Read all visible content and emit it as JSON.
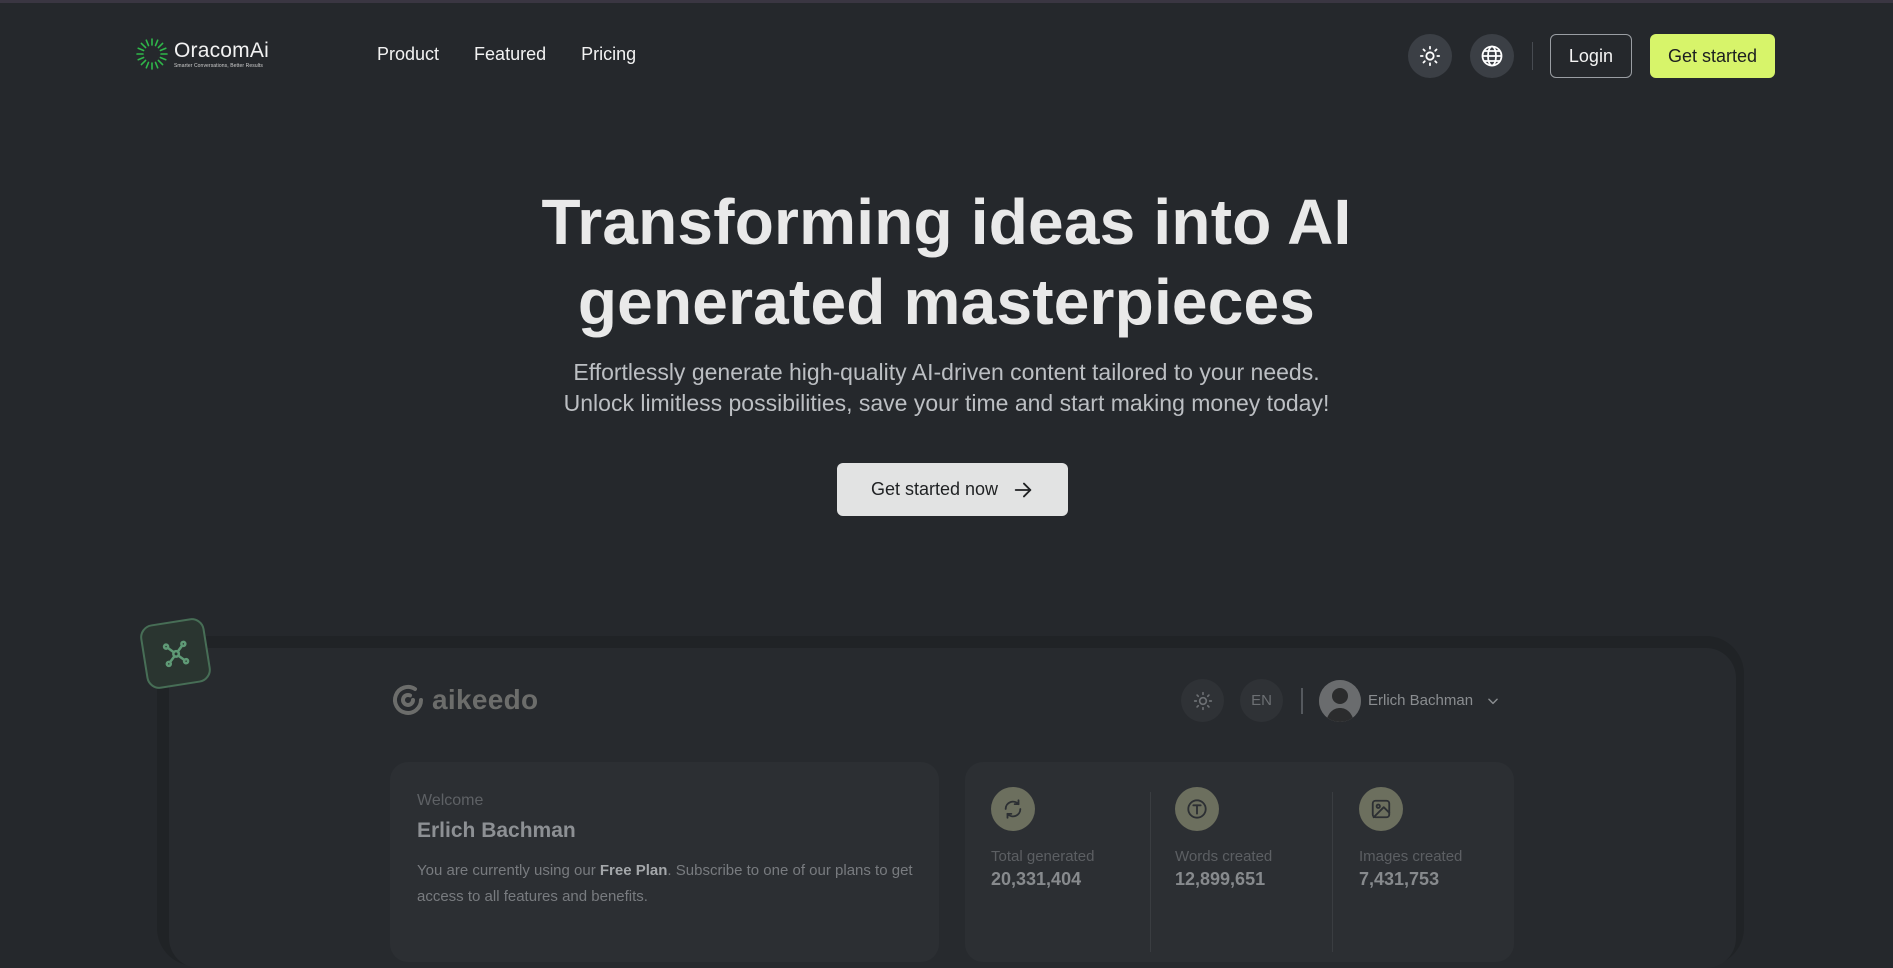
{
  "brand": {
    "name": "OracomAi",
    "tagline": "Smarter Conversations, Better Results",
    "accent_color": "#d7f46a",
    "logo_mark_color": "#2fb84a"
  },
  "nav": {
    "links": [
      "Product",
      "Featured",
      "Pricing"
    ],
    "theme_toggle_icon": "sun-icon",
    "language_icon": "globe-icon",
    "login_label": "Login",
    "cta_label": "Get started"
  },
  "hero": {
    "title_line1": "Transforming ideas into AI",
    "title_line2": "generated masterpieces",
    "subtitle_line1": "Effortlessly generate high-quality AI-driven content tailored to your needs.",
    "subtitle_line2": "Unlock limitless possibilities, save your time and start making money today!",
    "cta_label": "Get started now",
    "cta_icon": "arrow-right-icon"
  },
  "preview": {
    "floating_icon": "nodes-icon",
    "app_name": "aikeedo",
    "theme_icon": "sun-icon",
    "language_label": "EN",
    "user_name": "Erlich Bachman",
    "welcome": {
      "label": "Welcome",
      "name": "Erlich Bachman",
      "text_before": "You are currently using our ",
      "plan": "Free Plan",
      "text_after": ". Subscribe to one of our plans to get access to all features and benefits."
    },
    "stats": [
      {
        "icon": "refresh-icon",
        "label": "Total generated",
        "value": "20,331,404"
      },
      {
        "icon": "text-icon",
        "label": "Words created",
        "value": "12,899,651"
      },
      {
        "icon": "image-icon",
        "label": "Images created",
        "value": "7,431,753"
      }
    ]
  }
}
